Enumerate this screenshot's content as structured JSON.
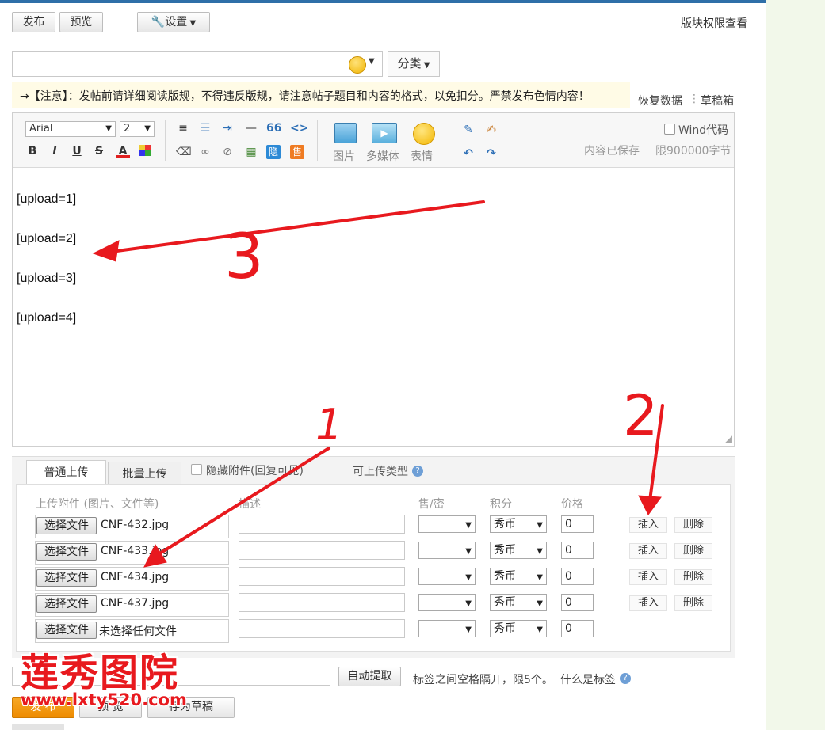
{
  "toolbar_top": {
    "publish_label": "发布",
    "preview_label": "预览",
    "settings_label": "设置",
    "permissions_link": "版块权限查看"
  },
  "title_row": {
    "title_value": "",
    "category_label": "分类"
  },
  "notice": {
    "text": "→【注意】：发帖前请详细阅读版规，不得违反版规，请注意帖子题目和内容的格式，以免扣分。严禁发布色情内容！",
    "restore_label": "恢复数据",
    "drafts_label": "草稿箱"
  },
  "editor": {
    "font_value": "Arial",
    "size_value": "2",
    "hide_label": "隐",
    "sell_label": "售",
    "image_label": "图片",
    "media_label": "多媒体",
    "emoji_label": "表情",
    "wind_code_label": "Wind代码",
    "saved_status": "内容已保存",
    "char_limit": "限900000字节",
    "content_lines": [
      "[upload=1]",
      "[upload=2]",
      "[upload=3]",
      "[upload=4]"
    ]
  },
  "upload": {
    "tab_normal": "普通上传",
    "tab_batch": "批量上传",
    "hide_attachment_label": "隐藏附件(回复可见)",
    "allowed_types_label": "可上传类型",
    "columns": {
      "attachment": "上传附件 (图片、文件等)",
      "description": "描述",
      "sale": "售/密",
      "points": "积分",
      "price": "价格"
    },
    "choose_file_label": "选择文件",
    "insert_label": "插入",
    "delete_label": "删除",
    "rows": [
      {
        "file": "CNF-432.jpg",
        "currency": "秀币",
        "price": "0"
      },
      {
        "file": "CNF-433.jpg",
        "currency": "秀币",
        "price": "0"
      },
      {
        "file": "CNF-434.jpg",
        "currency": "秀币",
        "price": "0"
      },
      {
        "file": "CNF-437.jpg",
        "currency": "秀币",
        "price": "0"
      },
      {
        "file": "未选择任何文件",
        "currency": "秀币",
        "price": "0"
      }
    ]
  },
  "tags": {
    "auto_extract_label": "自动提取",
    "hint": "标签之间空格隔开，限5个。",
    "what_is_tag": "什么是标签"
  },
  "bottom": {
    "publish_label": "发 布",
    "preview_label": "预 览",
    "draft_label": "存为草稿"
  },
  "annotations": {
    "n1": "1",
    "n2": "2",
    "n3": "3"
  },
  "watermark": {
    "name": "莲秀图院",
    "url": "www.lxty520.com"
  },
  "colors": {
    "accent_blue": "#2f6fa8",
    "annotation_red": "#e8191e",
    "publish_orange": "#f39800",
    "notice_bg": "#fffbe6",
    "side_green": "#f2f8ea"
  }
}
